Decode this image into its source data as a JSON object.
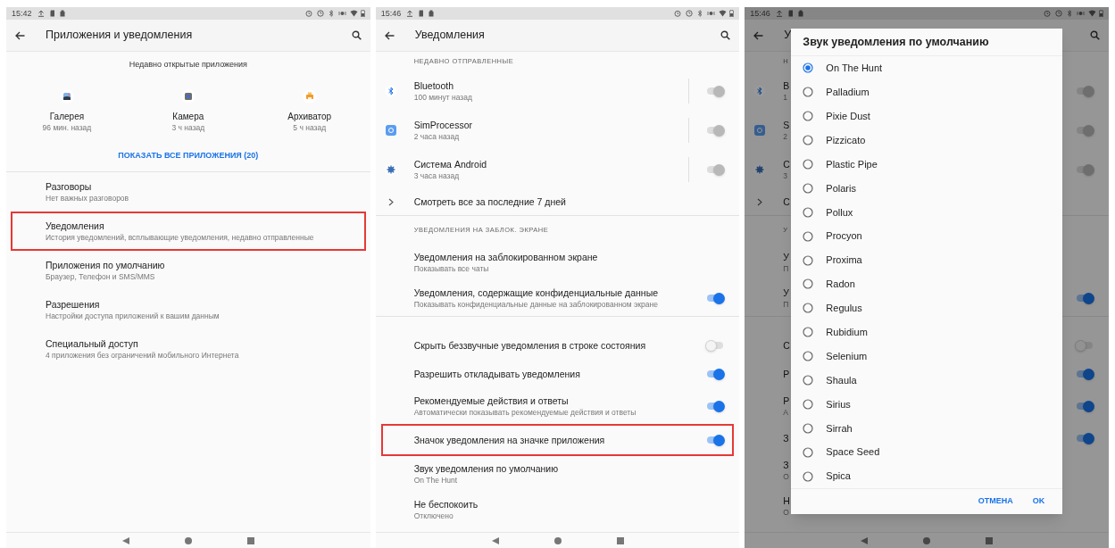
{
  "screens": [
    {
      "kind": "apps_overview",
      "status_time": "15:42",
      "title": "Приложения и уведомления",
      "recent_heading": "Недавно открытые приложения",
      "recent_apps": [
        {
          "name": "Галерея",
          "time": "96 мин. назад"
        },
        {
          "name": "Камера",
          "time": "3 ч назад"
        },
        {
          "name": "Архиватор",
          "time": "5 ч назад"
        }
      ],
      "show_all": "ПОКАЗАТЬ ВСЕ ПРИЛОЖЕНИЯ (20)",
      "items": [
        {
          "title": "Разговоры",
          "subtitle": "Нет важных разговоров",
          "highlighted": false
        },
        {
          "title": "Уведомления",
          "subtitle": "История уведомлений, всплывающие уведомления, недавно отправленные",
          "highlighted": true
        },
        {
          "title": "Приложения по умолчанию",
          "subtitle": "Браузер, Телефон и SMS/MMS",
          "highlighted": false
        },
        {
          "title": "Разрешения",
          "subtitle": "Настройки доступа приложений к вашим данным",
          "highlighted": false
        },
        {
          "title": "Специальный доступ",
          "subtitle": "4 приложения без ограничений мобильного Интернета",
          "highlighted": false
        }
      ]
    },
    {
      "kind": "notifications",
      "status_time": "15:46",
      "title": "Уведомления",
      "sections": [
        {
          "header": "НЕДАВНО ОТПРАВЛЕННЫЕ",
          "rows": [
            {
              "kind": "app",
              "title": "Bluetooth",
              "subtitle": "100 минут назад",
              "on": true,
              "disabled": true
            },
            {
              "kind": "app",
              "title": "SimProcessor",
              "subtitle": "2 часа назад",
              "on": true,
              "disabled": true
            },
            {
              "kind": "app",
              "title": "Система Android",
              "subtitle": "3 часа назад",
              "on": true,
              "disabled": true
            },
            {
              "kind": "link",
              "title": "Смотреть все за последние 7 дней"
            }
          ]
        },
        {
          "header": "УВЕДОМЛЕНИЯ НА ЗАБЛОК. ЭКРАНЕ",
          "rows": [
            {
              "kind": "setting",
              "title": "Уведомления на заблокированном экране",
              "subtitle": "Показывать все чаты",
              "highlighted": false
            },
            {
              "kind": "setting",
              "title": "Уведомления, содержащие конфиденциальные данные",
              "subtitle": "Показывать конфиденциальные данные на заблокированном экране",
              "on": true,
              "highlighted": false
            }
          ]
        },
        {
          "rows": [
            {
              "kind": "setting",
              "title": "Скрыть беззвучные уведомления в строке состояния",
              "on": false,
              "highlighted": false
            },
            {
              "kind": "setting",
              "title": "Разрешить откладывать уведомления",
              "on": true,
              "highlighted": false
            },
            {
              "kind": "setting",
              "title": "Рекомендуемые действия и ответы",
              "subtitle": "Автоматически показывать рекомендуемые действия и ответы",
              "on": true,
              "highlighted": false
            },
            {
              "kind": "setting",
              "title": "Значок уведомления на значке приложения",
              "on": true,
              "highlighted": true
            },
            {
              "kind": "setting",
              "title": "Звук уведомления по умолчанию",
              "subtitle": "On The Hunt",
              "highlighted": false
            },
            {
              "kind": "setting",
              "title": "Не беспокоить",
              "subtitle": "Отключено",
              "highlighted": false
            }
          ]
        }
      ]
    },
    {
      "kind": "sound_dialog",
      "status_time": "15:46",
      "background": {
        "title": "У",
        "sections": [
          {
            "header": "Н",
            "rows": [
              {
                "kind": "app",
                "title": "B",
                "subtitle": "1",
                "on": true,
                "disabled": true
              },
              {
                "kind": "app",
                "title": "S",
                "subtitle": "2",
                "on": true,
                "disabled": true
              },
              {
                "kind": "app",
                "title": "С",
                "subtitle": "3",
                "on": true,
                "disabled": true
              },
              {
                "kind": "link",
                "title": "С"
              }
            ]
          },
          {
            "header": "У",
            "rows": [
              {
                "kind": "setting",
                "title": "У",
                "subtitle": "П",
                "highlighted": false
              },
              {
                "kind": "setting",
                "title": "У",
                "subtitle": "П",
                "on": true,
                "highlighted": false
              }
            ]
          },
          {
            "rows": [
              {
                "kind": "setting",
                "title": "С",
                "on": false,
                "highlighted": false
              },
              {
                "kind": "setting",
                "title": "Р",
                "on": true,
                "highlighted": false
              },
              {
                "kind": "setting",
                "title": "Р",
                "subtitle": "А",
                "on": true,
                "highlighted": false
              },
              {
                "kind": "setting",
                "title": "З",
                "on": true,
                "highlighted": false
              },
              {
                "kind": "setting",
                "title": "З",
                "subtitle": "О",
                "highlighted": false
              },
              {
                "kind": "setting",
                "title": "Н",
                "subtitle": "О",
                "highlighted": false
              }
            ]
          }
        ]
      },
      "dialog": {
        "title": "Звук уведомления по умолчанию",
        "options": [
          {
            "label": "On The Hunt",
            "selected": true
          },
          {
            "label": "Palladium",
            "selected": false
          },
          {
            "label": "Pixie Dust",
            "selected": false
          },
          {
            "label": "Pizzicato",
            "selected": false
          },
          {
            "label": "Plastic Pipe",
            "selected": false
          },
          {
            "label": "Polaris",
            "selected": false
          },
          {
            "label": "Pollux",
            "selected": false
          },
          {
            "label": "Procyon",
            "selected": false
          },
          {
            "label": "Proxima",
            "selected": false
          },
          {
            "label": "Radon",
            "selected": false
          },
          {
            "label": "Regulus",
            "selected": false
          },
          {
            "label": "Rubidium",
            "selected": false
          },
          {
            "label": "Selenium",
            "selected": false
          },
          {
            "label": "Shaula",
            "selected": false
          },
          {
            "label": "Sirius",
            "selected": false
          },
          {
            "label": "Sirrah",
            "selected": false
          },
          {
            "label": "Space Seed",
            "selected": false
          },
          {
            "label": "Spica",
            "selected": false
          }
        ],
        "buttons": [
          "ОТМЕНА",
          "OK"
        ]
      }
    }
  ]
}
